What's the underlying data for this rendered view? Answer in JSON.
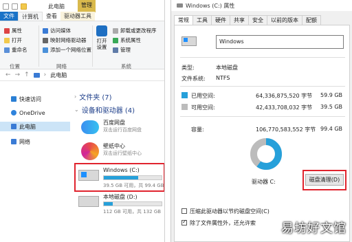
{
  "explorer": {
    "window_title": "此电脑",
    "mgmt_tab": "管理",
    "tabs": [
      "文件",
      "计算机",
      "查看",
      "驱动器工具"
    ],
    "ribbon": {
      "properties": "属性",
      "open": "打开",
      "rename": "重命名",
      "access_media": "访问媒体",
      "map_drive": "映射网络驱动器",
      "add_location": "添加一个网络位置",
      "open_settings": "打开\n设置",
      "uninstall": "卸载或更改程序",
      "system_props": "系统属性",
      "manage": "管理",
      "group_location": "位置",
      "group_network": "网络",
      "group_system": "系统"
    },
    "address": {
      "crumb": "此电脑"
    },
    "nav": [
      "快速访问",
      "OneDrive",
      "此电脑",
      "网络"
    ],
    "sections": {
      "folders": "文件夹 (7)",
      "devices": "设备和驱动器 (4)"
    },
    "drives": [
      {
        "name": "百度网盘",
        "sub": "双击运行百度网盘"
      },
      {
        "name": "壁纸中心",
        "sub": "双击运行壁纸中心"
      },
      {
        "name": "Windows (C:)",
        "free": "39.5 GB 可用，共 99.4 GB",
        "usage": 0.6
      },
      {
        "name": "本地磁盘 (D:)",
        "free": "112 GB 可用，共 132 GB",
        "usage": 0.15
      }
    ]
  },
  "props": {
    "title": "Windows (C:) 属性",
    "tabs": [
      "常规",
      "工具",
      "硬件",
      "共享",
      "安全",
      "以前的版本",
      "配额"
    ],
    "name_value": "Windows",
    "type_label": "类型:",
    "type_value": "本地磁盘",
    "fs_label": "文件系统:",
    "fs_value": "NTFS",
    "used_label": "已用空间:",
    "used_bytes": "64,336,875,520 字节",
    "used_gb": "59.9 GB",
    "free_label": "可用空间:",
    "free_bytes": "42,433,708,032 字节",
    "free_gb": "39.5 GB",
    "cap_label": "容量:",
    "cap_bytes": "106,770,583,552 字节",
    "cap_gb": "99.4 GB",
    "drive_label": "驱动器 C:",
    "cleanup_button": "磁盘清理(D)",
    "compress_label": "压缩此驱动器以节约磁盘空间(C)",
    "index_label": "除了文件属性外，还允许索",
    "used_fraction": 0.6,
    "colors": {
      "used": "#26a0da",
      "free": "#bcbcbc",
      "highlight": "#e0232d"
    }
  },
  "watermark": "易坊好文馆"
}
